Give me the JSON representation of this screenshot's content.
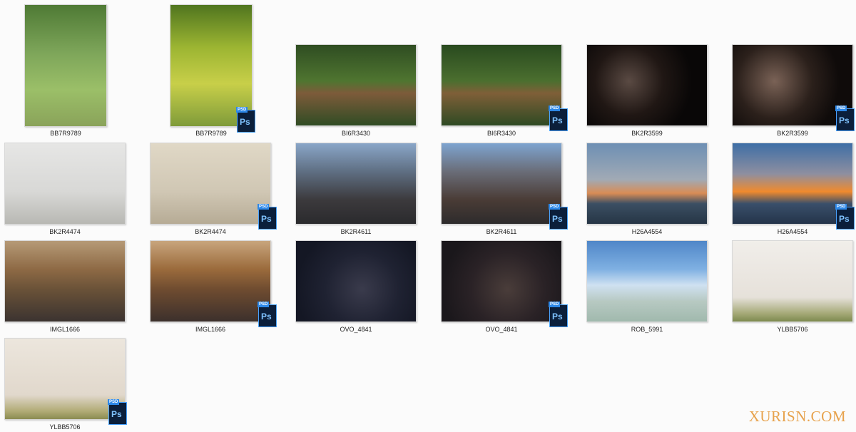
{
  "files": [
    {
      "name": "BB7R9789",
      "psd": false,
      "bg": "linear-gradient(180deg,#4f7a35 0%,#7ea65a 40%,#9bbf68 70%,#8aa35a 100%)"
    },
    {
      "name": "BB7R9789",
      "psd": true,
      "bg": "linear-gradient(180deg,#50751f 0%,#9cb532 35%,#c8cf49 65%,#7f9b3a 100%)"
    },
    {
      "name": "BI6R3430",
      "psd": false,
      "bg": "linear-gradient(180deg,#2f4d22 0%,#4f7530 45%,#7d5b3a 60%,#304c24 100%)"
    },
    {
      "name": "BI6R3430",
      "psd": true,
      "bg": "linear-gradient(180deg,#294a1f 0%,#4b6f2f 45%,#7f5f38 60%,#2e4a23 100%)"
    },
    {
      "name": "BK2R3599",
      "psd": false,
      "bg": "radial-gradient(circle at 35% 45%,#5a4a43 0%,#201714 38%,#090707 70%)"
    },
    {
      "name": "BK2R3599",
      "psd": true,
      "bg": "radial-gradient(circle at 35% 45%,#7a6256 0%,#2b201b 42%,#0f0b0a 72%)"
    },
    {
      "name": "BK2R4474",
      "psd": false,
      "bg": "linear-gradient(180deg,#e6e6e5 0%,#d8d8d6 60%,#b8b8b3 100%)"
    },
    {
      "name": "BK2R4474",
      "psd": true,
      "bg": "linear-gradient(180deg,#e0d8c6 0%,#d0c7b4 60%,#b6ab95 100%)"
    },
    {
      "name": "BK2R4611",
      "psd": false,
      "bg": "linear-gradient(180deg,#8aa6c8 0%,#5f6f83 35%,#3c3a3d 70%,#2a2a2d 100%)"
    },
    {
      "name": "BK2R4611",
      "psd": true,
      "bg": "linear-gradient(180deg,#7ea4d0 0%,#6a6d78 35%,#4a3c36 70%,#2d2b2c 100%)"
    },
    {
      "name": "H26A4554",
      "psd": false,
      "bg": "linear-gradient(180deg,#6d8fb4 0%,#a1aab5 45%,#d98c55 62%,#3b4f63 75%,#263545 100%)"
    },
    {
      "name": "H26A4554",
      "psd": true,
      "bg": "linear-gradient(180deg,#3e6ea6 0%,#8e8fa0 38%,#f08a2e 60%,#3a4f6a 75%,#24344a 100%)"
    },
    {
      "name": "IMGL1666",
      "psd": false,
      "bg": "linear-gradient(180deg,#b69a77 0%,#8e6a45 35%,#6a5238 60%,#3b3330 100%)"
    },
    {
      "name": "IMGL1666",
      "psd": true,
      "bg": "linear-gradient(180deg,#c8a57d 0%,#9b6b3c 35%,#6f4c30 60%,#3c302c 100%)"
    },
    {
      "name": "OVO_4841",
      "psd": false,
      "bg": "radial-gradient(circle at 55% 60%,#3a3b4c 0%,#1f2232 45%,#141724 80%)"
    },
    {
      "name": "OVO_4841",
      "psd": true,
      "bg": "radial-gradient(circle at 55% 60%,#4a3d3a 0%,#2a2226 45%,#1a171b 80%)"
    },
    {
      "name": "ROB_5991",
      "psd": false,
      "bg": "linear-gradient(180deg,#4f86c8 0%,#7fb0e2 35%,#cfe1f1 55%,#b7c9c2 75%,#a0b9ad 100%)"
    },
    {
      "name": "YLBB5706",
      "psd": false,
      "bg": "linear-gradient(180deg,#f1eeea 0%,#e6e1da 70%,#a5a977 90%,#7d8a4f 100%)"
    },
    {
      "name": "YLBB5706",
      "psd": true,
      "bg": "linear-gradient(180deg,#ece6dd 0%,#e1d8cc 70%,#b1ab76 90%,#8a8b51 100%)"
    }
  ],
  "watermark": "XURISN.COM",
  "psd_badge": {
    "tag": "PSD",
    "label": "Ps"
  }
}
